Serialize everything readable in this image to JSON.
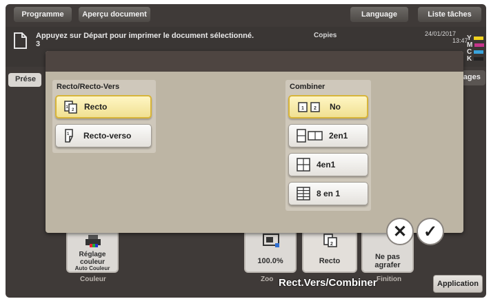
{
  "topbar": {
    "programme": "Programme",
    "apercu": "Aperçu document",
    "language": "Language",
    "liste_taches": "Liste tâches"
  },
  "message": {
    "line1": "Appuyez sur Départ pour imprimer le document sélectionné.",
    "line2": "3",
    "copies_label": "Copies",
    "date": "24/01/2017",
    "time": "13:47",
    "toner_letters": [
      "Y",
      "M",
      "C",
      "K"
    ],
    "toner_colors": [
      "#f1d21e",
      "#c7348b",
      "#3aa4dc",
      "#222222"
    ]
  },
  "tabs": {
    "left": "Prése",
    "right": "glages"
  },
  "popup": {
    "left_panel": {
      "title": "Recto/Recto-Vers",
      "options": [
        {
          "label": "Recto",
          "selected": true,
          "icon": "single-sided-icon"
        },
        {
          "label": "Recto-verso",
          "selected": false,
          "icon": "double-sided-icon"
        }
      ]
    },
    "right_panel": {
      "title": "Combiner",
      "options": [
        {
          "label": "No",
          "selected": true,
          "icon": "no-combine-icon"
        },
        {
          "label": "2en1",
          "selected": false,
          "icon": "two-in-one-icon"
        },
        {
          "label": "4en1",
          "selected": false,
          "icon": "four-in-one-icon"
        },
        {
          "label": "8 en 1",
          "selected": false,
          "icon": "eight-in-one-icon"
        }
      ]
    },
    "cancel_symbol": "✕",
    "ok_symbol": "✓"
  },
  "bottom": {
    "color_tile": {
      "text": "Réglage couleur",
      "sub": "Auto Couleur",
      "caption": "Couleur"
    },
    "zoom_tile": {
      "value": "100.0%",
      "caption": "Zoo"
    },
    "recto_tile": {
      "value": "Recto"
    },
    "staple_tile": {
      "line1": "Ne pas",
      "line2": "agrafer",
      "caption": "Finition"
    },
    "caption": "Rect.Vers/Combiner",
    "application": "Application"
  },
  "colors": {
    "selected_fill": "#f4e39c",
    "selected_border": "#d7b43a",
    "popup_bg": "#bdb5a4",
    "cancel_bg": "#ffffff",
    "ok_bg": "#ffffff"
  }
}
